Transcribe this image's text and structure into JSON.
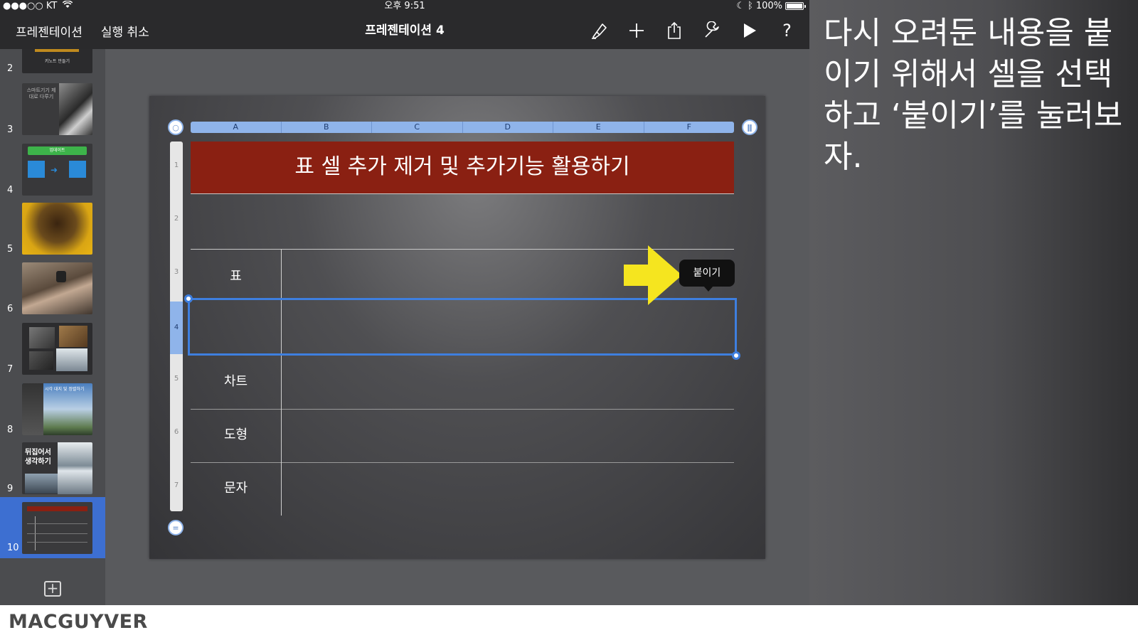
{
  "status_bar": {
    "carrier": "●●●○○ KT",
    "time": "오후 9:51",
    "battery": "100%"
  },
  "toolbar": {
    "back_label": "프레젠테이션",
    "undo_label": "실행 취소",
    "document_title": "프레젠테이션 4",
    "icons": [
      "format-brush-icon",
      "add-icon",
      "share-icon",
      "tools-wrench-icon",
      "play-icon",
      "help-icon"
    ]
  },
  "slides": [
    {
      "number": "2",
      "caption": "키노트 만들기"
    },
    {
      "number": "3",
      "caption": "스마트기기 제대로 다루기"
    },
    {
      "number": "4",
      "caption": "업데이트"
    },
    {
      "number": "5",
      "caption": ""
    },
    {
      "number": "6",
      "caption": ""
    },
    {
      "number": "7",
      "caption": ""
    },
    {
      "number": "8",
      "caption": "시각 대지 및 정렬하기"
    },
    {
      "number": "9",
      "caption": "뒤집어서 생각하기"
    },
    {
      "number": "10",
      "caption": ""
    }
  ],
  "table": {
    "columns": [
      "A",
      "B",
      "C",
      "D",
      "E",
      "F"
    ],
    "rows": [
      "1",
      "2",
      "3",
      "4",
      "5",
      "6",
      "7"
    ],
    "title": "표 셀 추가 제거 및 추가기능 활용하기",
    "row_labels": [
      "표",
      "",
      "차트",
      "도형",
      "문자"
    ]
  },
  "popover": {
    "paste_label": "붙이기"
  },
  "caption": {
    "text": "다시 오려둔 내용을 붙이기 위해서 셀을 선택하고 ‘붙이기’를 눌러보자."
  },
  "brand": "MACGUYVER",
  "colors": {
    "title_cell": "#8a2012",
    "selection": "#3e7fdf",
    "header_bar": "#8fb4ea",
    "arrow": "#f5e51f"
  }
}
